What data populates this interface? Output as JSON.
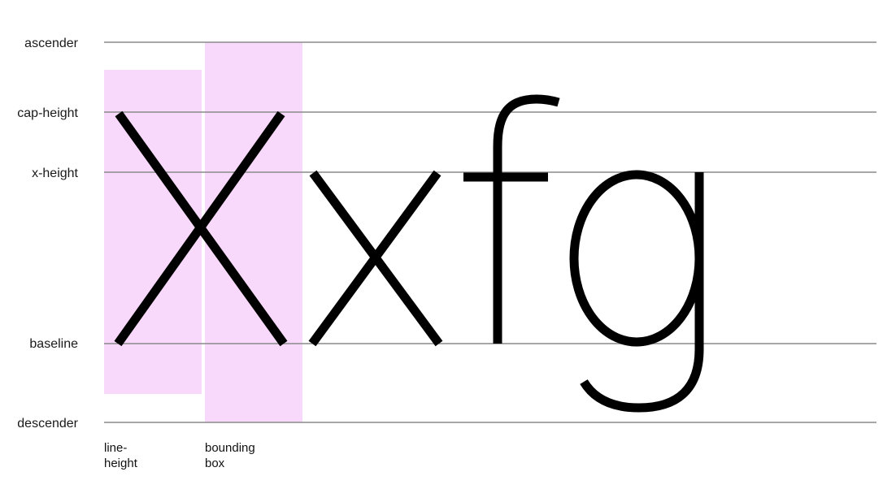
{
  "metrics": [
    {
      "key": "ascender",
      "label": "ascender"
    },
    {
      "key": "cap_height",
      "label": "cap-height"
    },
    {
      "key": "x_height",
      "label": "x-height"
    },
    {
      "key": "baseline",
      "label": "baseline"
    },
    {
      "key": "descender",
      "label": "descender"
    }
  ],
  "sample_text": "Xxfg",
  "captions": {
    "line_height": [
      "line-",
      "height"
    ],
    "bounding_box": [
      "bounding",
      "box"
    ]
  },
  "colors": {
    "highlight": "#f9d9fb",
    "guide_line": "#8a8a8a",
    "glyph": "#000000"
  }
}
